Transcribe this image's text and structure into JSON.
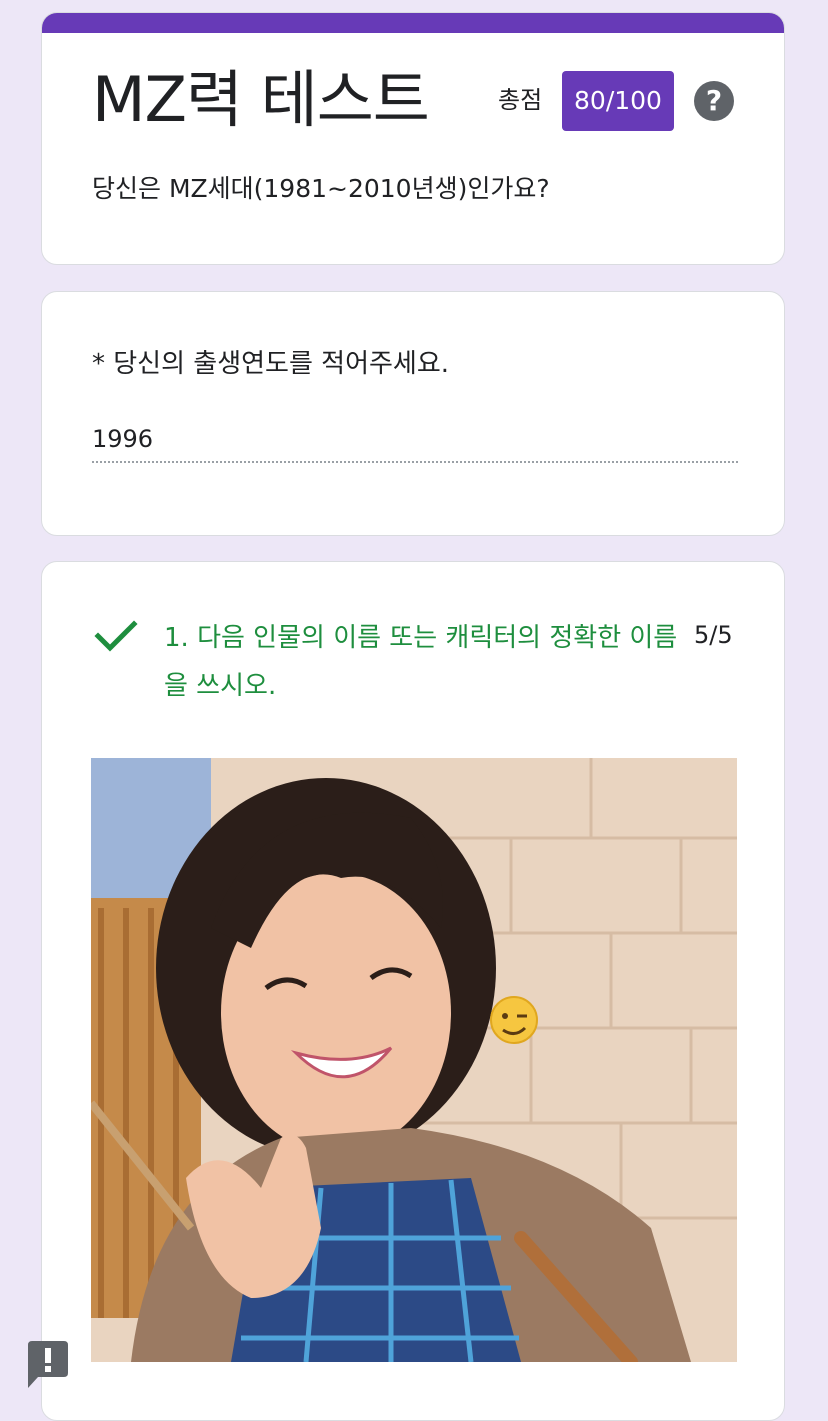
{
  "header": {
    "title": "MZ력 테스트",
    "score_label": "총점",
    "score_value": "80/100",
    "help_icon": "question-circle-icon",
    "description": "당신은 MZ세대(1981~2010년생)인가요?",
    "accent_color": "#673ab7"
  },
  "birth_question": {
    "label": "* 당신의 출생연도를 적어주세요.",
    "answer": "1996"
  },
  "question1": {
    "title": "1. 다음 인물의 이름 또는 캐릭터의 정확한 이름을 쓰시오.",
    "score": "5/5",
    "status_icon": "checkmark-icon",
    "status_color": "#1e8e3e",
    "image_emoji": "😉"
  },
  "footer": {
    "report_icon": "report-problem-icon"
  }
}
